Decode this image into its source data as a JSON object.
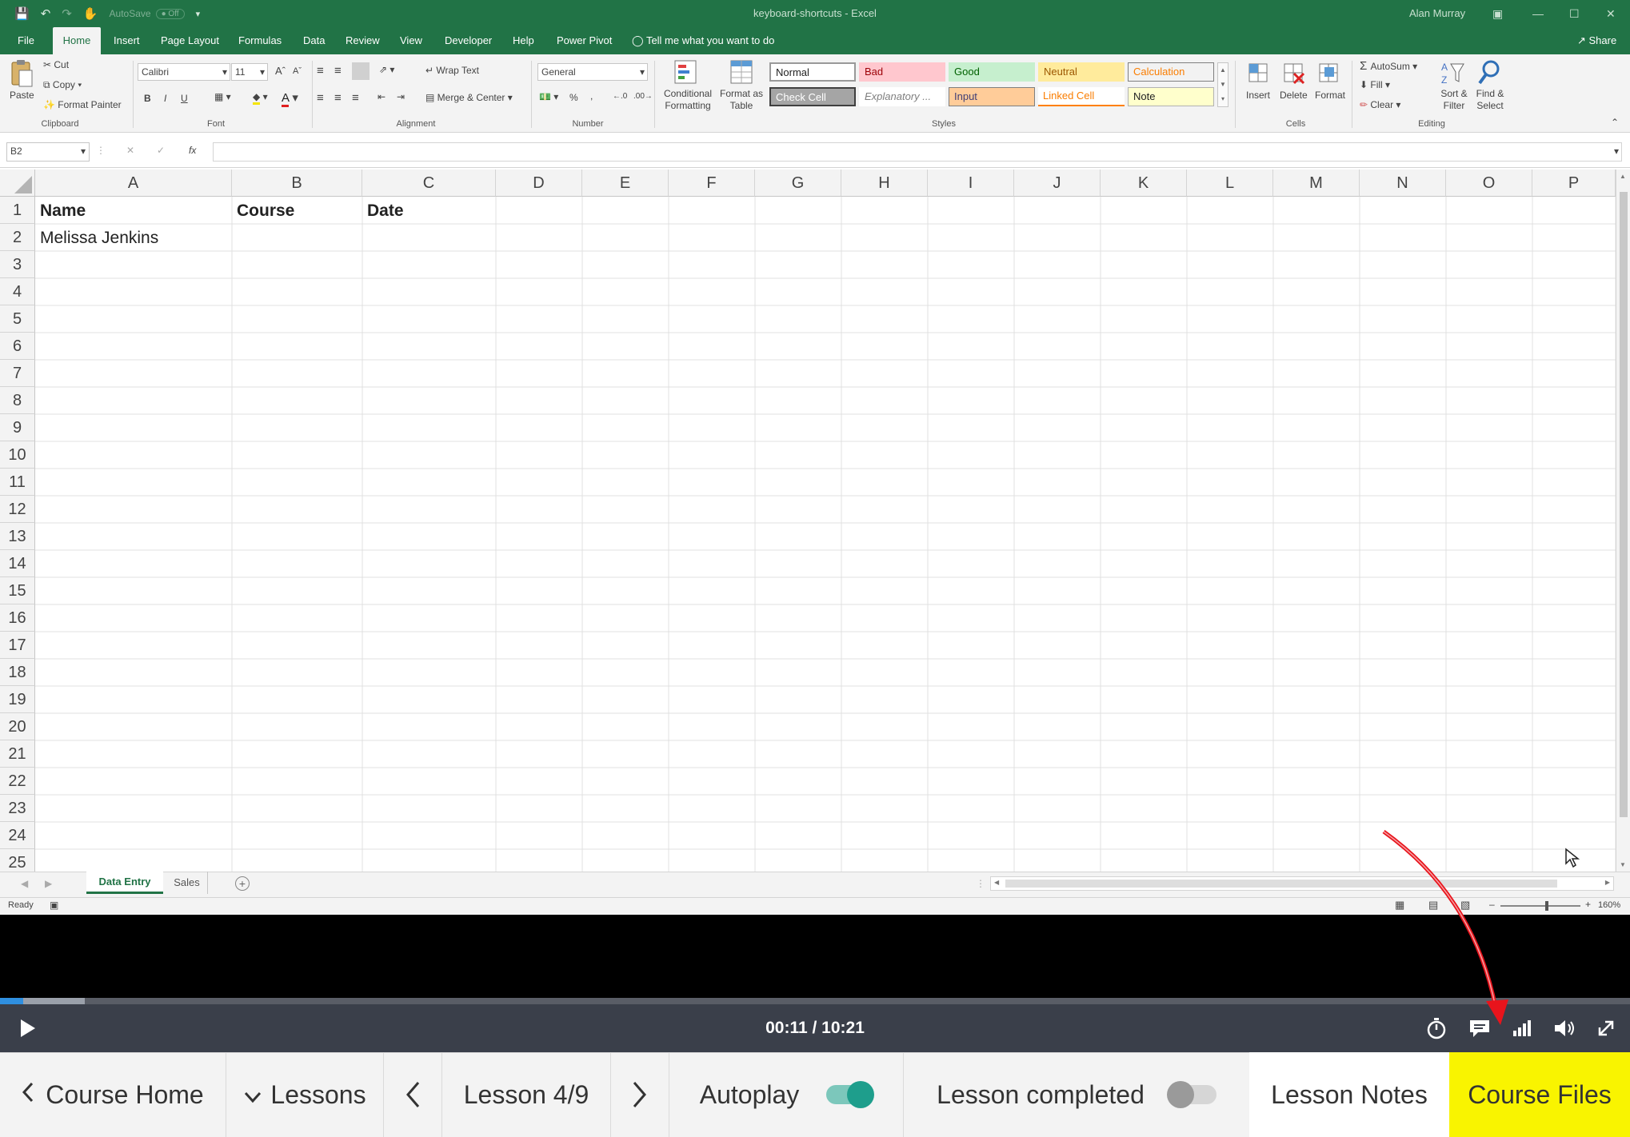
{
  "window": {
    "autosave_label": "AutoSave",
    "autosave_state": "Off",
    "document_title": "keyboard-shortcuts - Excel",
    "user": "Alan Murray"
  },
  "ribbon": {
    "tabs": [
      "File",
      "Home",
      "Insert",
      "Page Layout",
      "Formulas",
      "Data",
      "Review",
      "View",
      "Developer",
      "Help",
      "Power Pivot"
    ],
    "tell_me": "Tell me what you want to do",
    "share": "Share",
    "clipboard": {
      "paste": "Paste",
      "cut": "Cut",
      "copy": "Copy",
      "format_painter": "Format Painter",
      "title": "Clipboard"
    },
    "font": {
      "name": "Calibri",
      "size": "11",
      "bold": "B",
      "italic": "I",
      "underline": "U",
      "title": "Font"
    },
    "alignment": {
      "wrap_text": "Wrap Text",
      "merge_center": "Merge & Center",
      "title": "Alignment"
    },
    "number": {
      "format": "General",
      "percent": "%",
      "title": "Number"
    },
    "styles": {
      "conditional": "Conditional Formatting",
      "format_table": "Format as Table",
      "cells": [
        "Normal",
        "Bad",
        "Good",
        "Neutral",
        "Calculation",
        "Check Cell",
        "Explanatory ...",
        "Input",
        "Linked Cell",
        "Note"
      ],
      "title": "Styles"
    },
    "cells_group": {
      "insert": "Insert",
      "delete": "Delete",
      "format": "Format",
      "title": "Cells"
    },
    "editing": {
      "autosum": "AutoSum",
      "fill": "Fill",
      "clear": "Clear",
      "sort_filter": "Sort & Filter",
      "find_select": "Find & Select",
      "title": "Editing"
    }
  },
  "formula_bar": {
    "name_box": "B2",
    "fx": "fx",
    "content": ""
  },
  "sheet": {
    "columns": [
      "A",
      "B",
      "C",
      "D",
      "E",
      "F",
      "G",
      "H",
      "I",
      "J",
      "K",
      "L",
      "M",
      "N",
      "O",
      "P"
    ],
    "rows": [
      "1",
      "2",
      "3",
      "4",
      "5",
      "6",
      "7",
      "8",
      "9",
      "10",
      "11",
      "12",
      "13",
      "14",
      "15",
      "16",
      "17",
      "18",
      "19",
      "20",
      "21",
      "22",
      "23",
      "24",
      "25"
    ],
    "headers": {
      "a1": "Name",
      "b1": "Course",
      "c1": "Date"
    },
    "a2": "Melissa Jenkins",
    "tabs": [
      "Data Entry",
      "Sales"
    ],
    "active_tab": "Data Entry"
  },
  "status": {
    "ready": "Ready",
    "zoom": "160%"
  },
  "player": {
    "time": "00:11 / 10:21",
    "progress_buffered": 0.052,
    "progress_played": 0.014
  },
  "lesson_bar": {
    "course_home": "Course Home",
    "lessons": "Lessons",
    "lesson_position": "Lesson 4/9",
    "autoplay": "Autoplay",
    "autoplay_on": true,
    "lesson_completed": "Lesson completed",
    "lesson_completed_on": false,
    "lesson_notes": "Lesson Notes",
    "course_files": "Course Files"
  },
  "colors": {
    "excel_green": "#217346",
    "highlight": "#f9f400",
    "toggle_on": "#1e9e8c",
    "arrow_red": "#e8141c"
  }
}
